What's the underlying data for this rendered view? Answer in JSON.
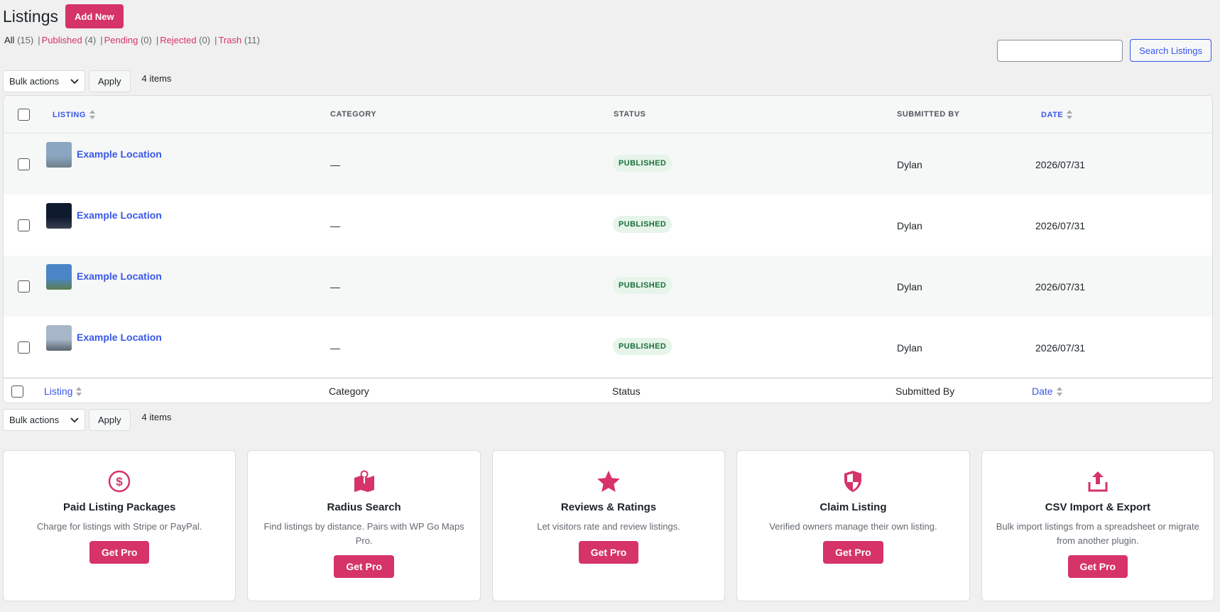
{
  "header": {
    "title": "Listings",
    "add_new": "Add New"
  },
  "filters": [
    {
      "label": "All",
      "count": "(15)"
    },
    {
      "label": "Published",
      "count": "(4)"
    },
    {
      "label": "Pending",
      "count": "(0)"
    },
    {
      "label": "Rejected",
      "count": "(0)"
    },
    {
      "label": "Trash",
      "count": "(11)"
    }
  ],
  "search": {
    "placeholder": "",
    "button": "Search Listings"
  },
  "tablenav": {
    "bulk_label": "Bulk actions",
    "apply": "Apply",
    "items": "4 items"
  },
  "columns": {
    "head": {
      "listing": "LISTING",
      "category": "CATEGORY",
      "status": "STATUS",
      "submitted_by": "SUBMITTED BY",
      "date": "DATE"
    },
    "foot": {
      "listing": "Listing",
      "category": "Category",
      "status": "Status",
      "submitted_by": "Submitted By",
      "date": "Date"
    }
  },
  "rows": [
    {
      "title": "Example Location",
      "category": "—",
      "status": "PUBLISHED",
      "author": "Dylan",
      "date": "2026/07/31",
      "thumb": [
        "#8aa6c1",
        "#6e7f89"
      ]
    },
    {
      "title": "Example Location",
      "category": "—",
      "status": "PUBLISHED",
      "author": "Dylan",
      "date": "2026/07/31",
      "thumb": [
        "#0f1a2e",
        "#3b3f52"
      ]
    },
    {
      "title": "Example Location",
      "category": "—",
      "status": "PUBLISHED",
      "author": "Dylan",
      "date": "2026/07/31",
      "thumb": [
        "#4a86c7",
        "#5c7d4e"
      ]
    },
    {
      "title": "Example Location",
      "category": "—",
      "status": "PUBLISHED",
      "author": "Dylan",
      "date": "2026/07/31",
      "thumb": [
        "#a7b7c9",
        "#5b6470"
      ]
    }
  ],
  "cards": [
    {
      "icon": "dollar-circle-icon",
      "title": "Paid Listing Packages",
      "desc": "Charge for listings with Stripe or PayPal.",
      "cta": "Get Pro"
    },
    {
      "icon": "map-pin-icon",
      "title": "Radius Search",
      "desc": "Find listings by distance. Pairs with WP Go Maps Pro.",
      "cta": "Get Pro"
    },
    {
      "icon": "star-icon",
      "title": "Reviews & Ratings",
      "desc": "Let visitors rate and review listings.",
      "cta": "Get Pro"
    },
    {
      "icon": "shield-icon",
      "title": "Claim Listing",
      "desc": "Verified owners manage their own listing.",
      "cta": "Get Pro"
    },
    {
      "icon": "upload-icon",
      "title": "CSV Import & Export",
      "desc": "Bulk import listings from a spreadsheet or migrate from another plugin.",
      "cta": "Get Pro"
    }
  ],
  "colors": {
    "accent": "#d63368",
    "link": "#3858e9",
    "badge_bg": "#e6f4ea",
    "badge_text": "#1b6f3b"
  }
}
